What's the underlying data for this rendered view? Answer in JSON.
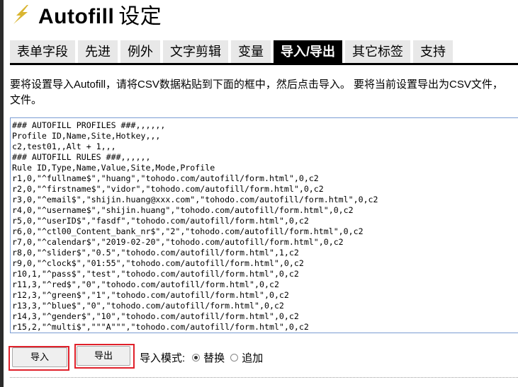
{
  "app": {
    "name": "Autofill",
    "subtitle": "设定"
  },
  "tabs": [
    {
      "label": "表单字段"
    },
    {
      "label": "先进"
    },
    {
      "label": "例外"
    },
    {
      "label": "文字剪辑"
    },
    {
      "label": "变量"
    },
    {
      "label": "导入/导出",
      "active": true
    },
    {
      "label": "其它标签"
    },
    {
      "label": "支持"
    }
  ],
  "description": {
    "line1": "要将设置导入Autofill，请将CSV数据粘贴到下面的框中，然后点击导入。 要将当前设置导出为CSV文件，",
    "line2": "文件。"
  },
  "csv_lines": [
    "### AUTOFILL PROFILES ###,,,,,,",
    "Profile ID,Name,Site,Hotkey,,,",
    "c2,test01,,Alt + 1,,,",
    "### AUTOFILL RULES ###,,,,,,",
    "Rule ID,Type,Name,Value,Site,Mode,Profile",
    "r1,0,\"^fullname$\",\"huang\",\"tohodo.com/autofill/form.html\",0,c2",
    "r2,0,\"^firstname$\",\"vidor\",\"tohodo.com/autofill/form.html\",0,c2",
    "r3,0,\"^email$\",\"shijin.huang@xxx.com\",\"tohodo.com/autofill/form.html\",0,c2",
    "r4,0,\"^username$\",\"shijin.huang\",\"tohodo.com/autofill/form.html\",0,c2",
    "r5,0,\"^userID$\",\"fasdf\",\"tohodo.com/autofill/form.html\",0,c2",
    "r6,0,\"^ctl00_Content_bank_nr$\",\"2\",\"tohodo.com/autofill/form.html\",0,c2",
    "r7,0,\"^calendar$\",\"2019-02-20\",\"tohodo.com/autofill/form.html\",0,c2",
    "r8,0,\"^slider$\",\"0.5\",\"tohodo.com/autofill/form.html\",1,c2",
    "r9,0,\"^clock$\",\"01:55\",\"tohodo.com/autofill/form.html\",0,c2",
    "r10,1,\"^pass$\",\"test\",\"tohodo.com/autofill/form.html\",0,c2",
    "r11,3,\"^red$\",\"0\",\"tohodo.com/autofill/form.html\",0,c2",
    "r12,3,\"^green$\",\"1\",\"tohodo.com/autofill/form.html\",0,c2",
    "r13,3,\"^blue$\",\"0\",\"tohodo.com/autofill/form.html\",0,c2",
    "r14,3,\"^gender$\",\"10\",\"tohodo.com/autofill/form.html\",0,c2",
    "r15,2,\"^multi$\",\"\"\"A\"\"\",\"tohodo.com/autofill/form.html\",0,c2"
  ],
  "buttons": {
    "import_label": "导入",
    "export_label": "导出"
  },
  "import_mode": {
    "label": "导入模式:",
    "options": [
      {
        "label": "替换",
        "selected": true
      },
      {
        "label": "追加",
        "selected": false
      }
    ]
  },
  "icons": {
    "logo": "lightning-bolt-icon"
  },
  "colors": {
    "active_tab_bg": "#000000",
    "highlight": "#e0202a",
    "textbox_border": "#7a9cd3",
    "logo": "#d9b531"
  }
}
